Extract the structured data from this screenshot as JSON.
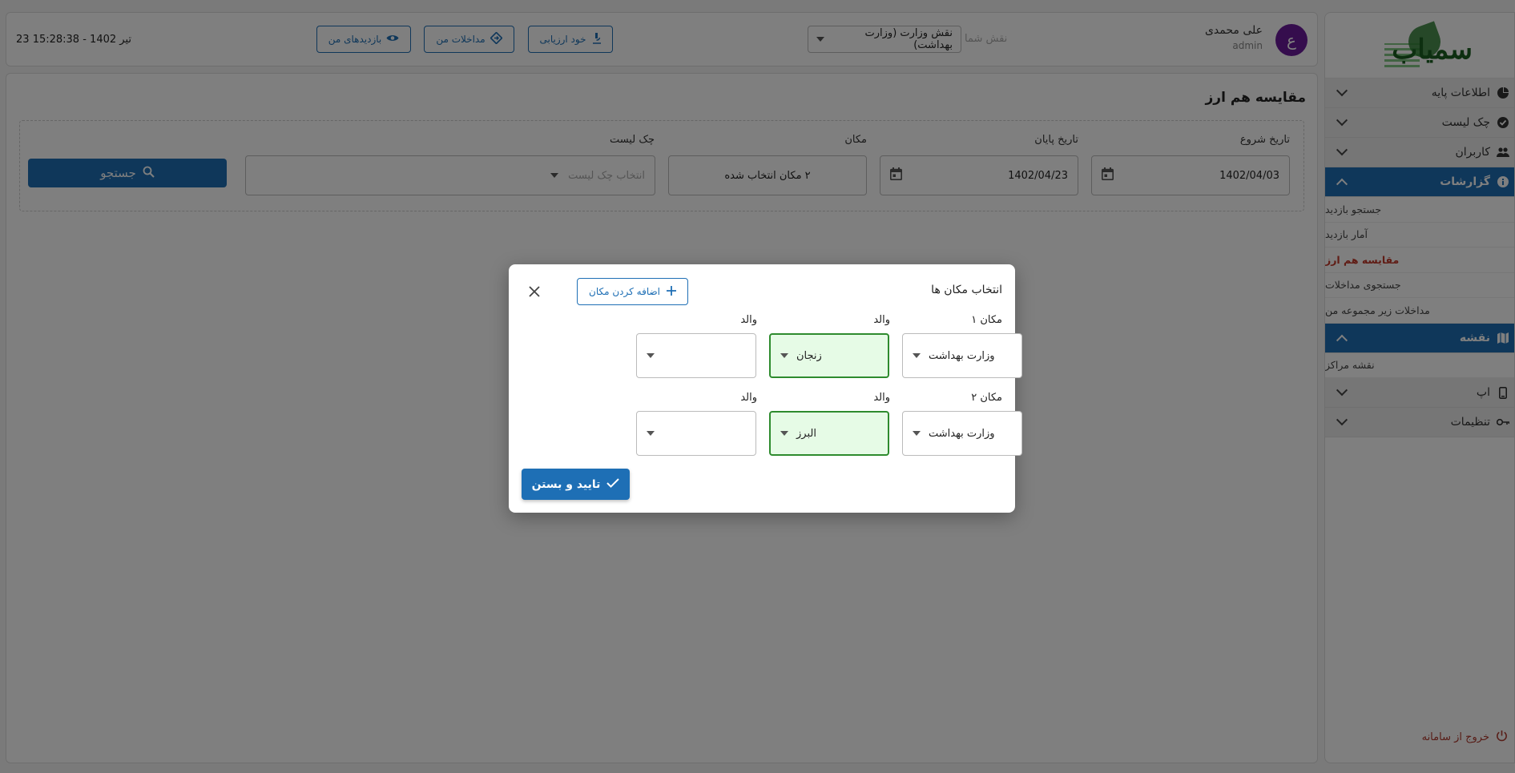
{
  "sidebar": {
    "logo_text": "سمیاب",
    "menu": [
      {
        "label": "اطلاعات پایه",
        "icon": "pie-chart-icon"
      },
      {
        "label": "چک لیست",
        "icon": "check-circle-icon"
      },
      {
        "label": "کاربران",
        "icon": "users-icon"
      },
      {
        "label": "گزارشات",
        "icon": "info-icon",
        "sub": [
          "جستجو بازدید",
          "آمار بازدید",
          "مقایسه هم ارز",
          "جستجوی مداخلات",
          "مداخلات زیر مجموعه من"
        ]
      },
      {
        "label": "نقشه",
        "icon": "map-icon",
        "sub": [
          "نقشه مراکز"
        ]
      },
      {
        "label": "اپ",
        "icon": "mobile-icon"
      },
      {
        "label": "تنظیمات",
        "icon": "key-icon"
      }
    ],
    "logout": "خروج از سامانه"
  },
  "header": {
    "avatar_letter": "ع",
    "user_name": "علی محمدی",
    "user_role": "admin",
    "role_label": "نقش شما",
    "role_value": "نقش وزارت (وزارت بهداشت)",
    "buttons": {
      "self_eval": "خود ارزیابی",
      "interventions": "مداخلات من",
      "visits": "بازدیدهای من"
    },
    "datetime": "23 تیر 1402 - 15:28:38"
  },
  "page": {
    "title": "مقایسه هم ارز",
    "filters": {
      "start_label": "تاریخ شروع",
      "start_value": "1402/04/03",
      "end_label": "تاریخ پایان",
      "end_value": "1402/04/23",
      "place_label": "مکان",
      "place_value": "۲ مکان انتخاب شده",
      "checklist_label": "چک لیست",
      "checklist_placeholder": "انتخاب چک لیست"
    },
    "search_button": "جستجو"
  },
  "modal": {
    "title": "انتخاب مکان ها",
    "add_button": "اضافه کردن مکان",
    "rows": [
      {
        "label": "مکان ۱",
        "parent_label": "والد",
        "values": [
          "وزارت بهداشت",
          "زنجان",
          ""
        ]
      },
      {
        "label": "مکان ۲",
        "parent_label": "والد",
        "values": [
          "وزارت بهداشت",
          "البرز",
          ""
        ]
      }
    ],
    "confirm_button": "تایید و بستن"
  }
}
